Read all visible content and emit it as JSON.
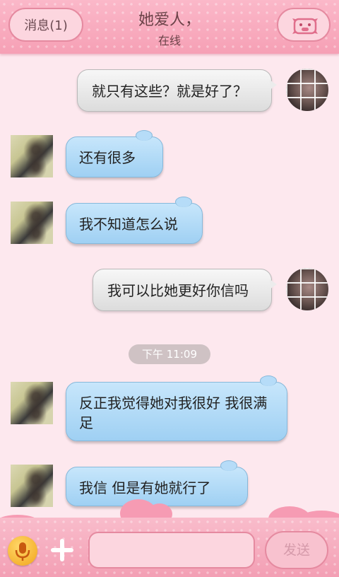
{
  "header": {
    "back_label": "消息(1)",
    "contact_name": "她爱人，",
    "contact_status": "在线",
    "profile_icon": "pig-face-icon"
  },
  "messages": [
    {
      "direction": "sent",
      "text": "就只有这些？就是好了？"
    },
    {
      "direction": "received",
      "text": "还有很多"
    },
    {
      "direction": "received",
      "text": "我不知道怎么说"
    },
    {
      "direction": "sent",
      "text": "我可以比她更好你信吗"
    },
    {
      "direction": "received",
      "text": "反正我觉得她对我很好 我很满足"
    },
    {
      "direction": "received",
      "text": "我信 但是有她就行了"
    }
  ],
  "timestamp": "下午 11:09",
  "footer": {
    "mic_icon": "microphone-icon",
    "plus_icon": "plus-icon",
    "input_value": "",
    "send_label": "发送"
  },
  "colors": {
    "header_pink": "#f6a0b5",
    "background": "#fde8ee",
    "received_bubble": "#a8d6f5",
    "sent_bubble": "#e6e6e6",
    "mic_yellow": "#f2a41a"
  }
}
